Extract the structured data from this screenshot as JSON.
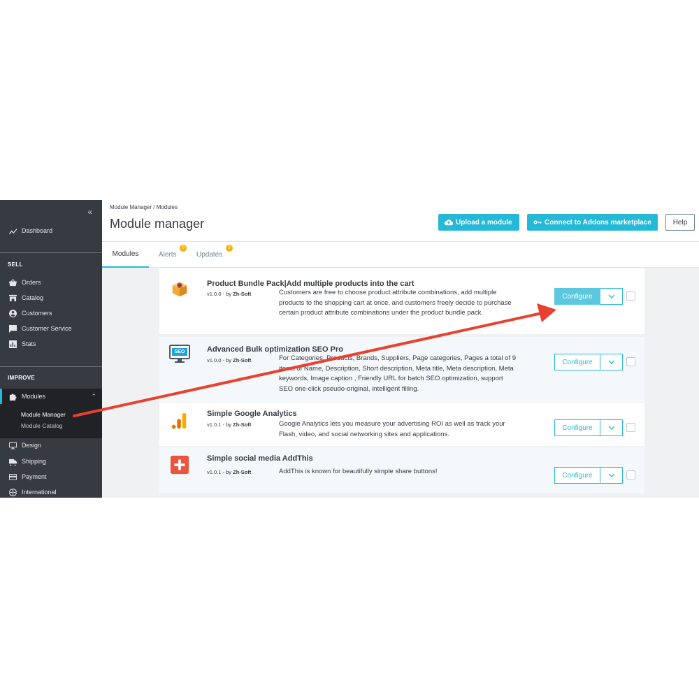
{
  "sidebar": {
    "collapse_glyph": "«",
    "dashboard": "Dashboard",
    "section_sell": "SELL",
    "sell_items": [
      "Orders",
      "Catalog",
      "Customers",
      "Customer Service",
      "Stats"
    ],
    "section_improve": "IMPROVE",
    "modules": "Modules",
    "sub_items": [
      "Module Manager",
      "Module Catalog"
    ],
    "more_items": [
      "Design",
      "Shipping",
      "Payment",
      "International"
    ]
  },
  "header": {
    "breadcrumb": [
      "Module Manager",
      "Modules"
    ],
    "breadcrumb_sep": "/",
    "title": "Module manager",
    "upload_label": "Upload a module",
    "connect_label": "Connect to Addons marketplace",
    "help_label": "Help"
  },
  "tabs": [
    {
      "label": "Modules",
      "badge": ""
    },
    {
      "label": "Alerts",
      "badge": "0"
    },
    {
      "label": "Updates",
      "badge": "3"
    }
  ],
  "modules": [
    {
      "name": "Product Bundle Pack|Add multiple products into the cart",
      "version": "v1.0.0 - by ",
      "author": "Zh-Soft",
      "description": "Customers are free to choose product attribute combinations, add multiple products to the shopping cart at once, and customers freely decide to purchase certain product attribute combinations under the product bundle pack.",
      "action": "Configure"
    },
    {
      "name": "Advanced Bulk optimization SEO Pro",
      "version": "v1.0.0 - by ",
      "author": "Zh-Soft",
      "description": "For Categories, Products, Brands, Suppliers, Page categories, Pages a total of 9 items of Name, Description, Short description, Meta title, Meta description, Meta keywords, Image caption , Friendly URL for batch SEO optimization, support SEO one-click pseudo-original, intelligent filling.",
      "action": "Configure",
      "icon_text": "SEO"
    },
    {
      "name": "Simple Google Analytics",
      "version": "v1.0.1 - by ",
      "author": "Zh-Soft",
      "description": "Google Analytics lets you measure your advertising ROI as well as track your Flash, video, and social networking sites and applications.",
      "action": "Configure"
    },
    {
      "name": "Simple social media AddThis",
      "version": "v1.0.1 - by ",
      "author": "Zh-Soft",
      "description": "AddThis is known for beautifully simple share buttons!",
      "action": "Configure"
    }
  ],
  "colors": {
    "accent": "#25b9d7",
    "sidebar_bg": "#363a41",
    "arrow": "#e8412f",
    "badge": "#fab000"
  }
}
